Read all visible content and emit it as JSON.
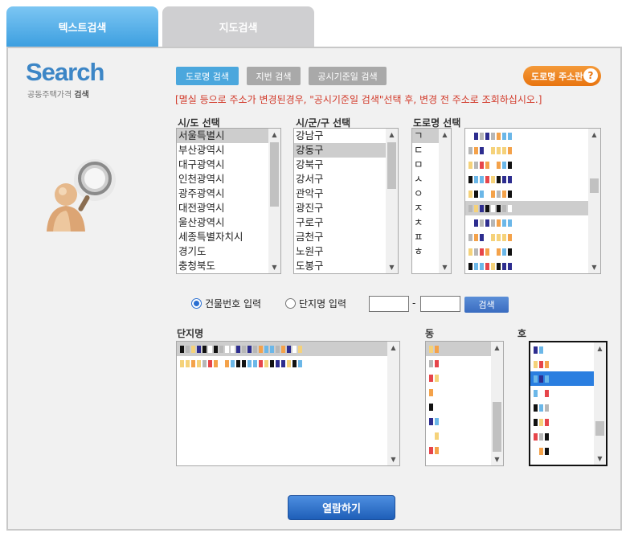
{
  "tabs": [
    {
      "label": "텍스트검색",
      "active": true
    },
    {
      "label": "지도검색",
      "active": false
    }
  ],
  "logo": {
    "title": "Search",
    "subtitle": "공동주택가격",
    "subtitle_bold": "검색"
  },
  "search_types": {
    "road": "도로명 검색",
    "jibun": "지번 검색",
    "date": "공시기준일 검색"
  },
  "help_button": {
    "label": "도로명 주소란",
    "icon": "question-icon",
    "glyph": "?"
  },
  "notice": "[멸실 등으로 주소가 변경된경우, \"공시기준일 검색\"선택 후, 변경 전 주소로 조회하십시오.]",
  "labels": {
    "sido": "시/도 선택",
    "sigungu": "시/군/구 선택",
    "road": "도로명 선택",
    "danji": "단지명",
    "dong": "동",
    "ho": "호"
  },
  "sido_list": [
    "서울특별시",
    "부산광역시",
    "대구광역시",
    "인천광역시",
    "광주광역시",
    "대전광역시",
    "울산광역시",
    "세종특별자치시",
    "경기도",
    "충청북도"
  ],
  "sido_selected": 0,
  "sigungu_list": [
    "강남구",
    "강동구",
    "강북구",
    "강서구",
    "관악구",
    "광진구",
    "구로구",
    "금천구",
    "노원구",
    "도봉구"
  ],
  "sigungu_selected": 1,
  "consonant_list": [
    "ㄱ",
    "ㄷ",
    "ㅁ",
    "ㅅ",
    "ㅇ",
    "ㅈ",
    "ㅊ",
    "ㅍ",
    "ㅎ"
  ],
  "consonant_selected": 0,
  "radios": {
    "building": "건물번호 입력",
    "danji": "단지명 입력",
    "selected": "building"
  },
  "range_separator": "-",
  "search_button": "검색",
  "view_button": "열람하기",
  "colors": {
    "accent": "#3d9fe0",
    "notice": "#d23a2a",
    "help": "#e8740f",
    "selection": "#2a7ee0"
  }
}
